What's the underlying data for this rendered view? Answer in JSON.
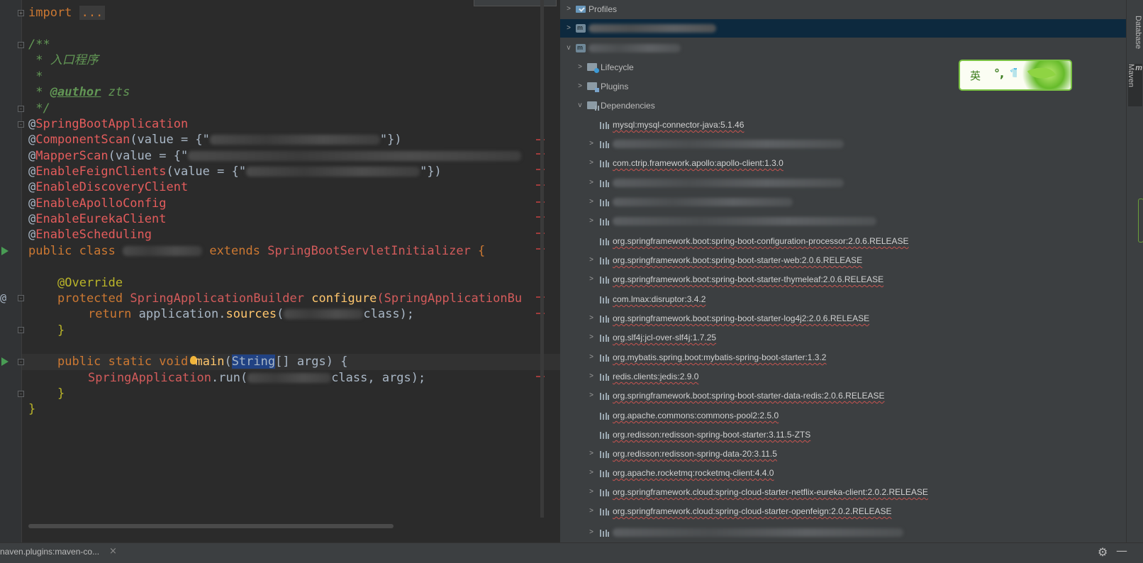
{
  "editor": {
    "lines": {
      "l1": "import",
      "l1_folded": "...",
      "l3": "/**",
      "l4": " * 入口程序",
      "l5": " *",
      "l6_pre": " * ",
      "l6_tag": "@author",
      "l6_val": " zts",
      "l7": " */",
      "l8": "SpringBootApplication",
      "l9_ann": "ComponentScan",
      "l9_mid": "(value = {\"",
      "l9_end": "\"})",
      "l10_ann": "MapperScan",
      "l10_mid": "(value = {\"",
      "l11_ann": "EnableFeignClients",
      "l11_mid": "(value = {\"",
      "l11_end": "\"})",
      "l12": "EnableDiscoveryClient",
      "l13": "EnableApolloConfig",
      "l14": "EnableEurekaClient",
      "l15": "EnableScheduling",
      "l16_kw": "public class",
      "l16_ext": "extends",
      "l16_cls": "SpringBootServletInitializer",
      "l16_end": " {",
      "l18": "@Override",
      "l19_kw": "protected",
      "l19_cls": "SpringApplicationBuilder",
      "l19_fn": "configure",
      "l19_arg": "(SpringApplicationBu",
      "l20_kw": "return",
      "l20_mid": " application.",
      "l20_fn": "sources",
      "l20_end": "class);",
      "l21": "}",
      "l23_kw": "public static void",
      "l23_fn": "main",
      "l23_sel": "String",
      "l23_end": "[] args) {",
      "l24_cls": "SpringApplication",
      "l24_mid": ".run(",
      "l24_end": "class, args);",
      "l25": "}",
      "l26": "}"
    }
  },
  "maven": {
    "profiles": "Profiles",
    "lifecycle": "Lifecycle",
    "plugins": "Plugins",
    "dependencies": "Dependencies",
    "deps": [
      "mysql:mysql-connector-java:5.1.46",
      "com.ctrip.framework.apollo:apollo-client:1.3.0",
      "org.springframework.boot:spring-boot-configuration-processor:2.0.6.RELEASE",
      "org.springframework.boot:spring-boot-starter-web:2.0.6.RELEASE",
      "org.springframework.boot:spring-boot-starter-thymeleaf:2.0.6.RELEASE",
      "com.lmax:disruptor:3.4.2",
      "org.springframework.boot:spring-boot-starter-log4j2:2.0.6.RELEASE",
      "org.slf4j:jcl-over-slf4j:1.7.25",
      "org.mybatis.spring.boot:mybatis-spring-boot-starter:1.3.2",
      "redis.clients:jedis:2.9.0",
      "org.springframework.boot:spring-boot-starter-data-redis:2.0.6.RELEASE",
      "org.apache.commons:commons-pool2:2.5.0",
      "org.redisson:redisson-spring-boot-starter:3.11.5-ZTS",
      "org.redisson:redisson-spring-data-20:3.11.5",
      "org.apache.rocketmq:rocketmq-client:4.4.0",
      "org.springframework.cloud:spring-cloud-starter-netflix-eureka-client:2.0.2.RELEASE",
      "org.springframework.cloud:spring-cloud-starter-openfeign:2.0.2.RELEASE"
    ]
  },
  "ime": {
    "lang": "英",
    "punct": "°,",
    "skin_icon": "shirt-icon"
  },
  "tool_stripe": {
    "database": "Database",
    "maven_m": "m",
    "maven": "Maven"
  },
  "bottom": {
    "tab": "naven.plugins:maven-co...",
    "close": "×",
    "gear": "⚙",
    "minimize": "—"
  },
  "colors": {
    "keyword": "#cc7832",
    "annotation": "#bbb529",
    "string": "#6a8759",
    "comment": "#629755",
    "function": "#ffc66d",
    "selection": "#214283"
  }
}
